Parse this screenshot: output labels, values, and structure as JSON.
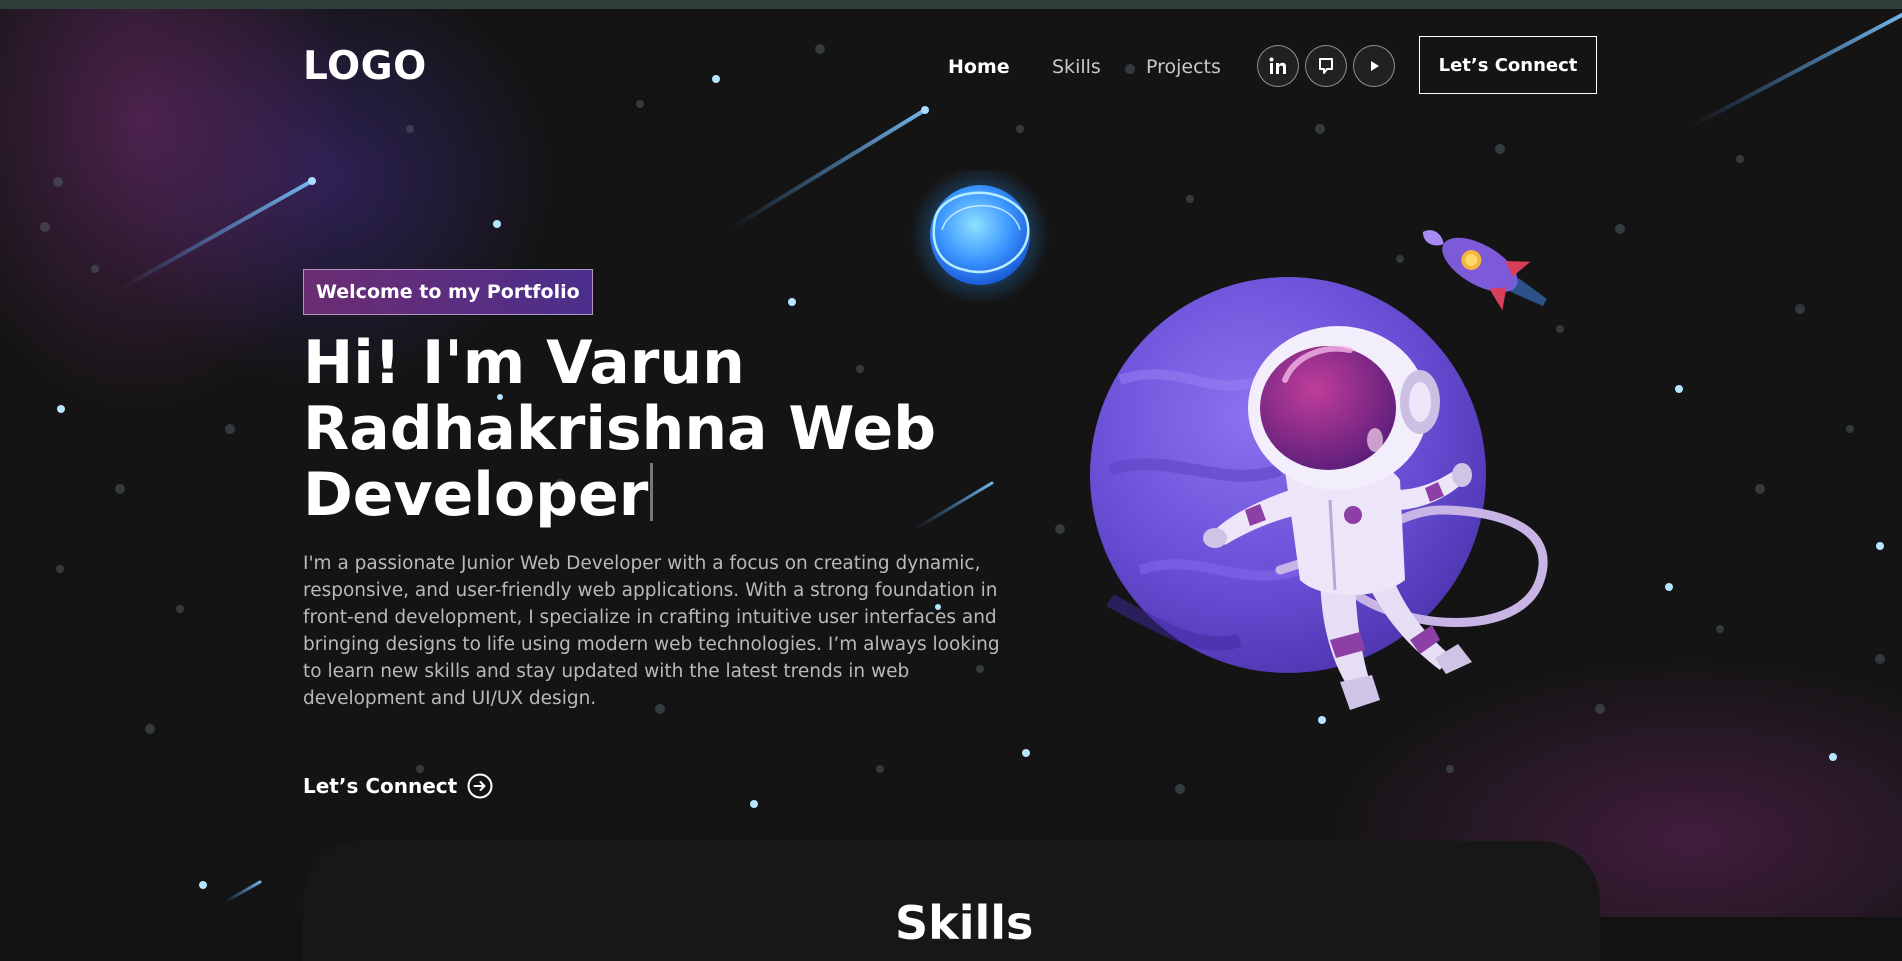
{
  "nav": {
    "logo": "LOGO",
    "links": [
      {
        "label": "Home",
        "active": true
      },
      {
        "label": "Skills",
        "active": false
      },
      {
        "label": "Projects",
        "active": false
      }
    ],
    "social_icons": [
      "linkedin-icon",
      "github-icon",
      "play-icon"
    ],
    "connect_label": "Let’s Connect"
  },
  "hero": {
    "badge": "Welcome to my Portfolio",
    "title": "Hi! I'm Varun Radhakrishna Web Developer",
    "description": "I'm a passionate Junior Web Developer with a focus on creating dynamic, responsive, and user-friendly web applications. With a strong foundation in front-end development, I specialize in crafting intuitive user interfaces and bringing designs to life using modern web technologies. I’m always looking to learn new skills and stay updated with the latest trends in web development and UI/UX design.",
    "cta_label": "Let’s Connect",
    "cta_icon": "arrow-right-circle-icon",
    "illustration": "astronaut-planet-illustration"
  },
  "skills": {
    "title": "Skills"
  },
  "colors": {
    "background": "#121212",
    "badge_gradient_start": "#6b2c72",
    "badge_gradient_end": "#4c2f8c",
    "planet": "#6a4fd6",
    "star": "#aee4ff"
  }
}
